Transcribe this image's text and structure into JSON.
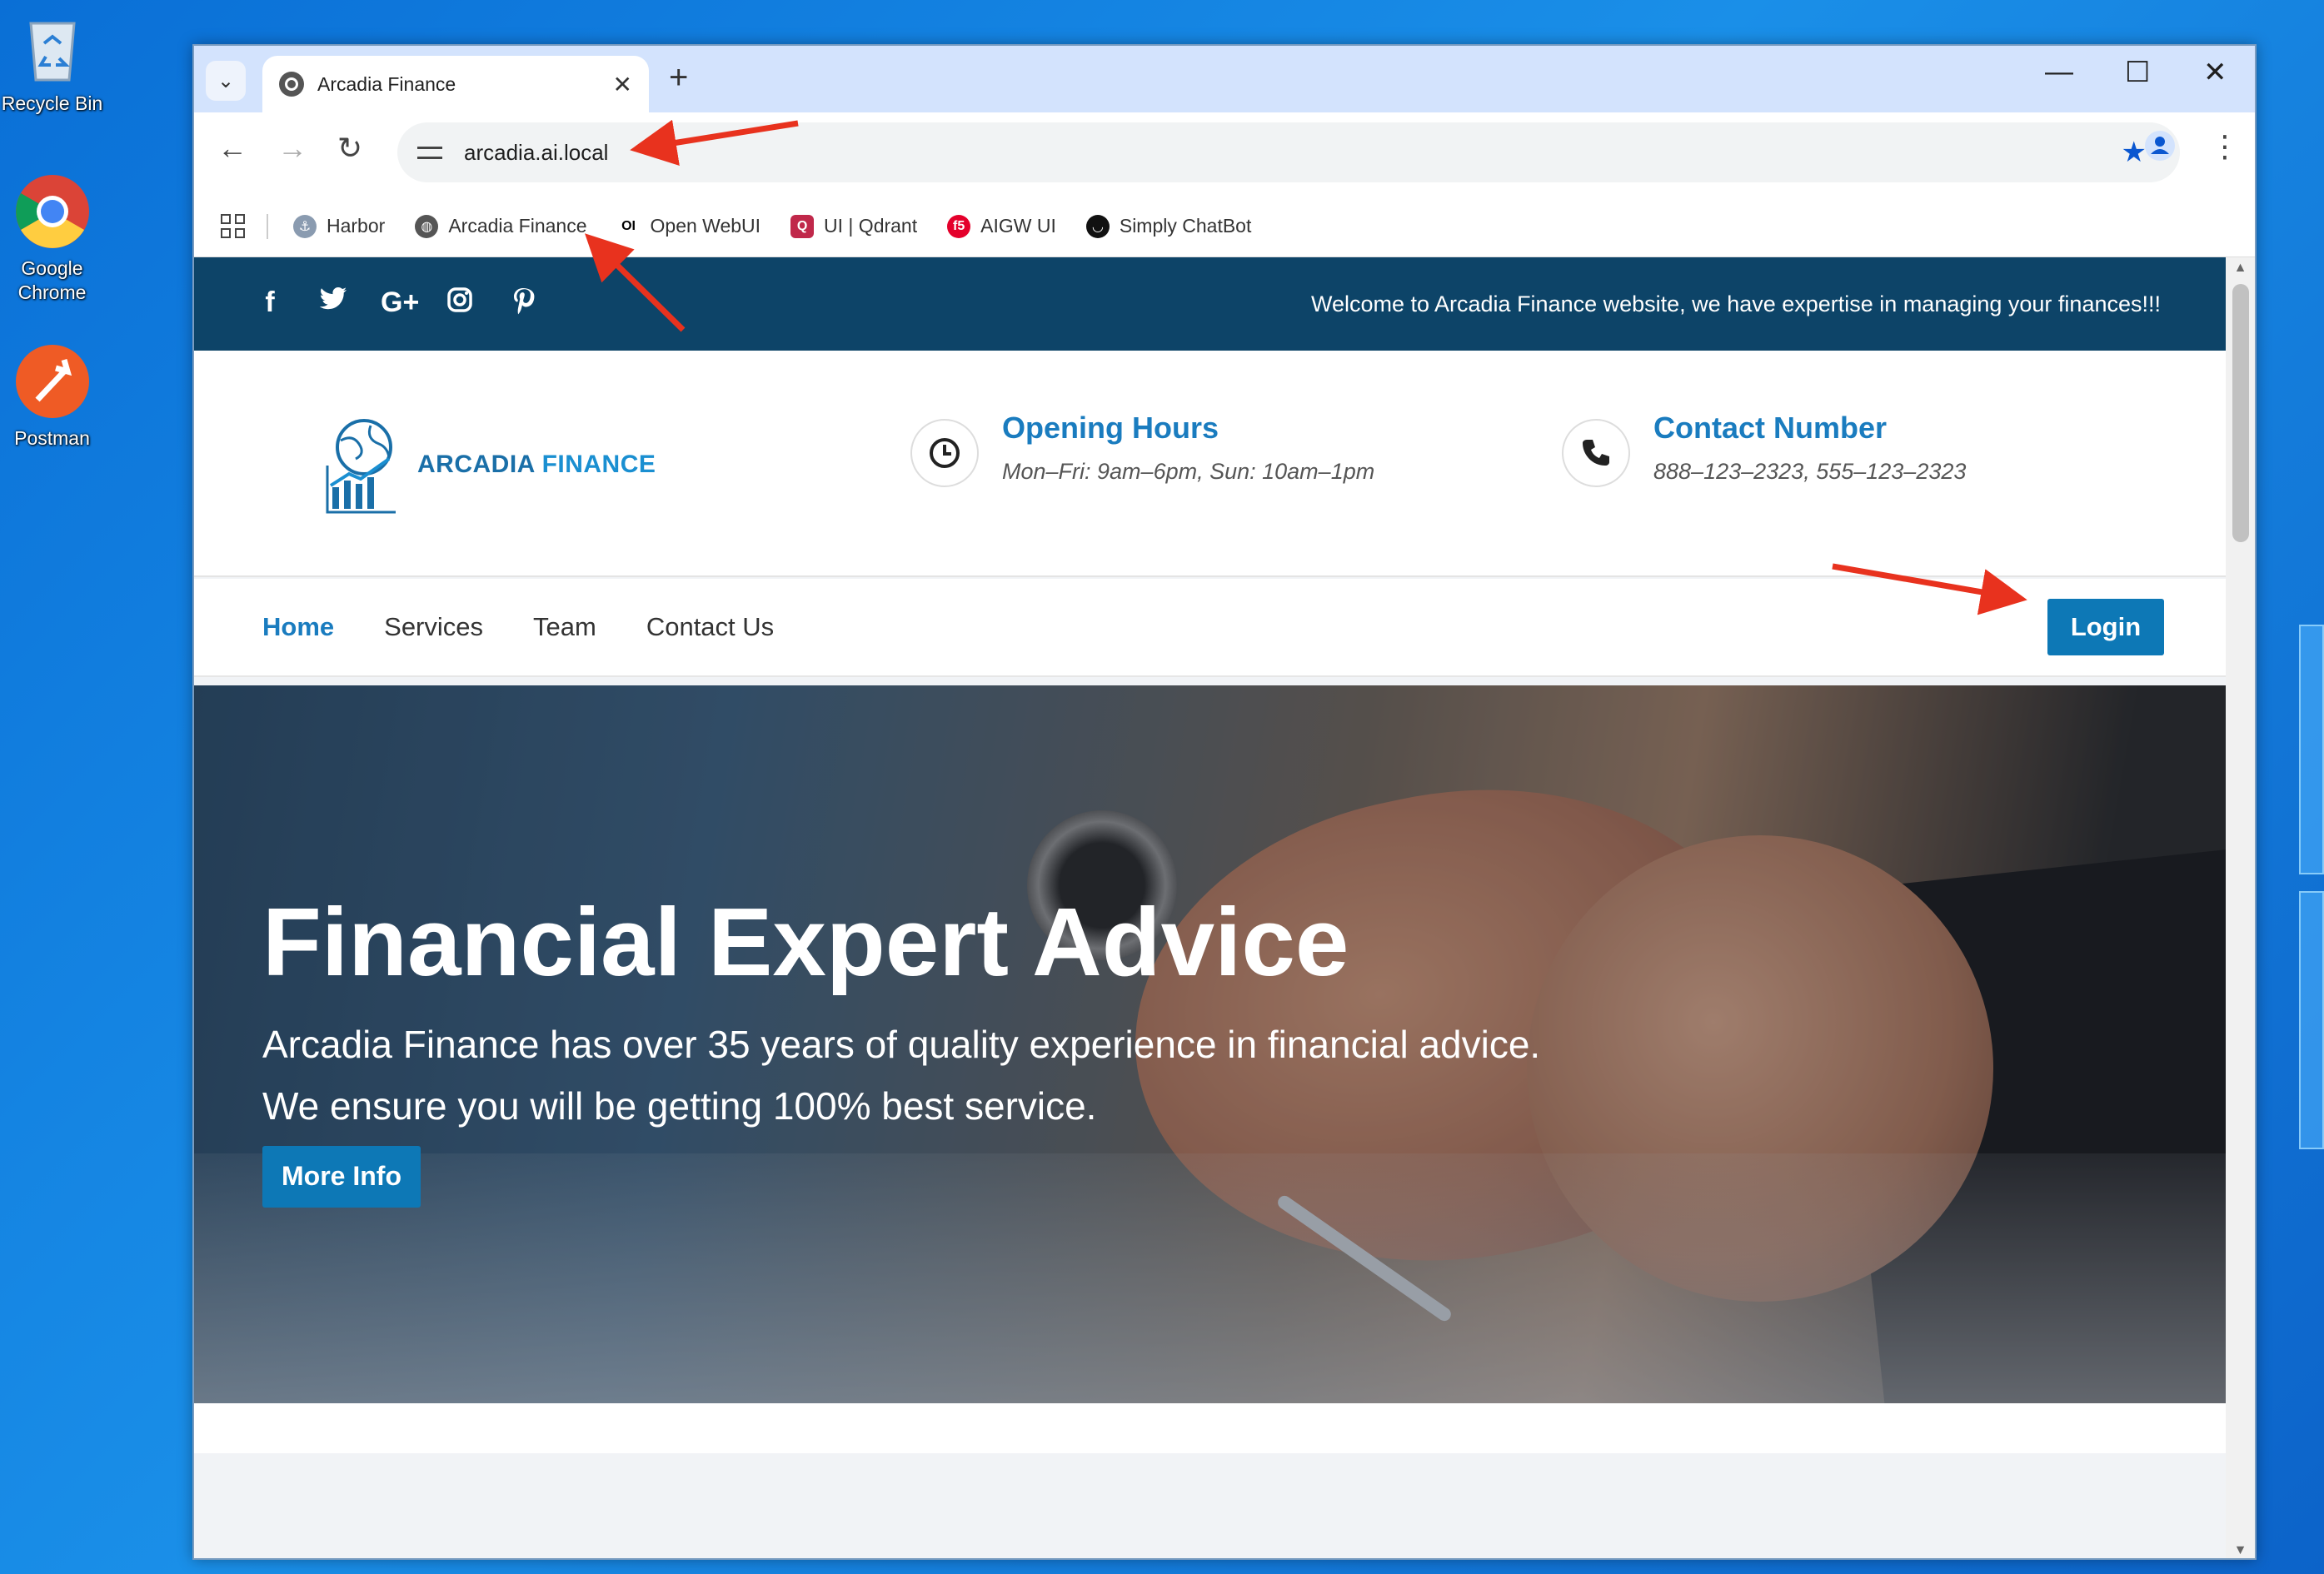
{
  "desktop": {
    "icons": [
      {
        "label": "Recycle Bin"
      },
      {
        "label": "Google Chrome"
      },
      {
        "label": "Postman"
      }
    ]
  },
  "browser": {
    "tab_title": "Arcadia Finance",
    "url": "arcadia.ai.local",
    "bookmarks": [
      {
        "label": "Harbor",
        "icon": "harbor-icon"
      },
      {
        "label": "Arcadia Finance",
        "icon": "globe-icon"
      },
      {
        "label": "Open WebUI",
        "icon": "openwebui-icon"
      },
      {
        "label": "UI | Qdrant",
        "icon": "qdrant-icon"
      },
      {
        "label": "AIGW UI",
        "icon": "f5-icon"
      },
      {
        "label": "Simply ChatBot",
        "icon": "chatbot-icon"
      }
    ]
  },
  "site": {
    "welcome": "Welcome to Arcadia Finance website, we have expertise in managing your finances!!!",
    "social": [
      "facebook-icon",
      "twitter-icon",
      "google-plus-icon",
      "instagram-icon",
      "pinterest-icon"
    ],
    "logo": {
      "word1": "ARCADIA",
      "word2": "FINANCE"
    },
    "hours": {
      "title": "Opening Hours",
      "text": "Mon–Fri: 9am–6pm, Sun: 10am–1pm"
    },
    "contact": {
      "title": "Contact Number",
      "text": "888–123–2323, 555–123–2323"
    },
    "nav": {
      "home": "Home",
      "services": "Services",
      "team": "Team",
      "contact": "Contact Us",
      "login": "Login"
    },
    "hero": {
      "title": "Financial Expert Advice",
      "line1": "Arcadia Finance has over 35 years of quality experience in financial advice.",
      "line2": "We ensure you will be getting 100% best service.",
      "button": "More Info"
    }
  },
  "colors": {
    "accent": "#0d78b6",
    "topbar": "#0d4468",
    "annotation": "#e8321e"
  }
}
